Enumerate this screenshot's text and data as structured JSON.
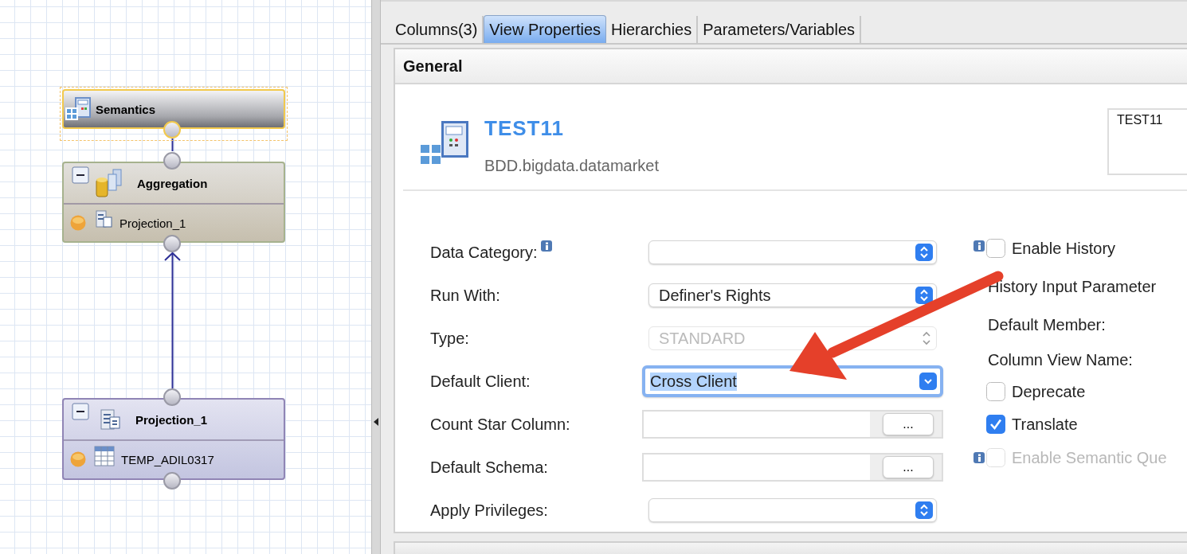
{
  "diagram": {
    "nodes": [
      {
        "kind": "semantics",
        "title": "Semantics",
        "selected": true
      },
      {
        "kind": "aggregation",
        "title": "Aggregation",
        "selected": false,
        "expanded": true,
        "inputs": [
          "Projection_1"
        ]
      },
      {
        "kind": "projection",
        "title": "Projection_1",
        "selected": false,
        "expanded": true,
        "inputs": [
          "TEMP_ADIL0317"
        ]
      }
    ]
  },
  "tabs": [
    {
      "label": "Columns(3)",
      "selected": false
    },
    {
      "label": "View Properties",
      "selected": true
    },
    {
      "label": "Hierarchies",
      "selected": false
    },
    {
      "label": "Parameters/Variables",
      "selected": false
    }
  ],
  "section": {
    "title": "General"
  },
  "view": {
    "name": "TEST11",
    "package": "BDD.bigdata.datamarket",
    "label_box": "TEST11"
  },
  "fields": [
    {
      "kind": "select",
      "label": "Data Category:",
      "info": true,
      "disabled": false,
      "focused": false
    },
    {
      "kind": "select",
      "label": "Run With:",
      "info": false,
      "value": "Definer's Rights",
      "disabled": false,
      "focused": false
    },
    {
      "kind": "select",
      "label": "Type:",
      "info": false,
      "value": "STANDARD",
      "disabled": true,
      "focused": false
    },
    {
      "kind": "select",
      "label": "Default Client:",
      "info": false,
      "value": "Cross Client",
      "disabled": false,
      "focused": true
    },
    {
      "kind": "browse",
      "label": "Count Star Column:",
      "info": false,
      "button": "..."
    },
    {
      "kind": "browse",
      "label": "Default Schema:",
      "info": false,
      "button": "..."
    },
    {
      "kind": "select",
      "label": "Apply Privileges:",
      "info": false,
      "disabled": false,
      "focused": false
    }
  ],
  "options": [
    {
      "kind": "checkbox",
      "label": "Enable History",
      "info": true,
      "checked": false,
      "disabled": false
    },
    {
      "kind": "label",
      "label": "History Input Parameter"
    },
    {
      "kind": "label",
      "label": "Default Member:"
    },
    {
      "kind": "label",
      "label": "Column View Name:"
    },
    {
      "kind": "checkbox",
      "label": "Deprecate",
      "info": false,
      "checked": false,
      "disabled": false
    },
    {
      "kind": "checkbox",
      "label": "Translate",
      "info": false,
      "checked": true,
      "disabled": false
    },
    {
      "kind": "checkbox",
      "label": "Enable Semantic Que",
      "info": true,
      "checked": false,
      "disabled": true
    }
  ]
}
